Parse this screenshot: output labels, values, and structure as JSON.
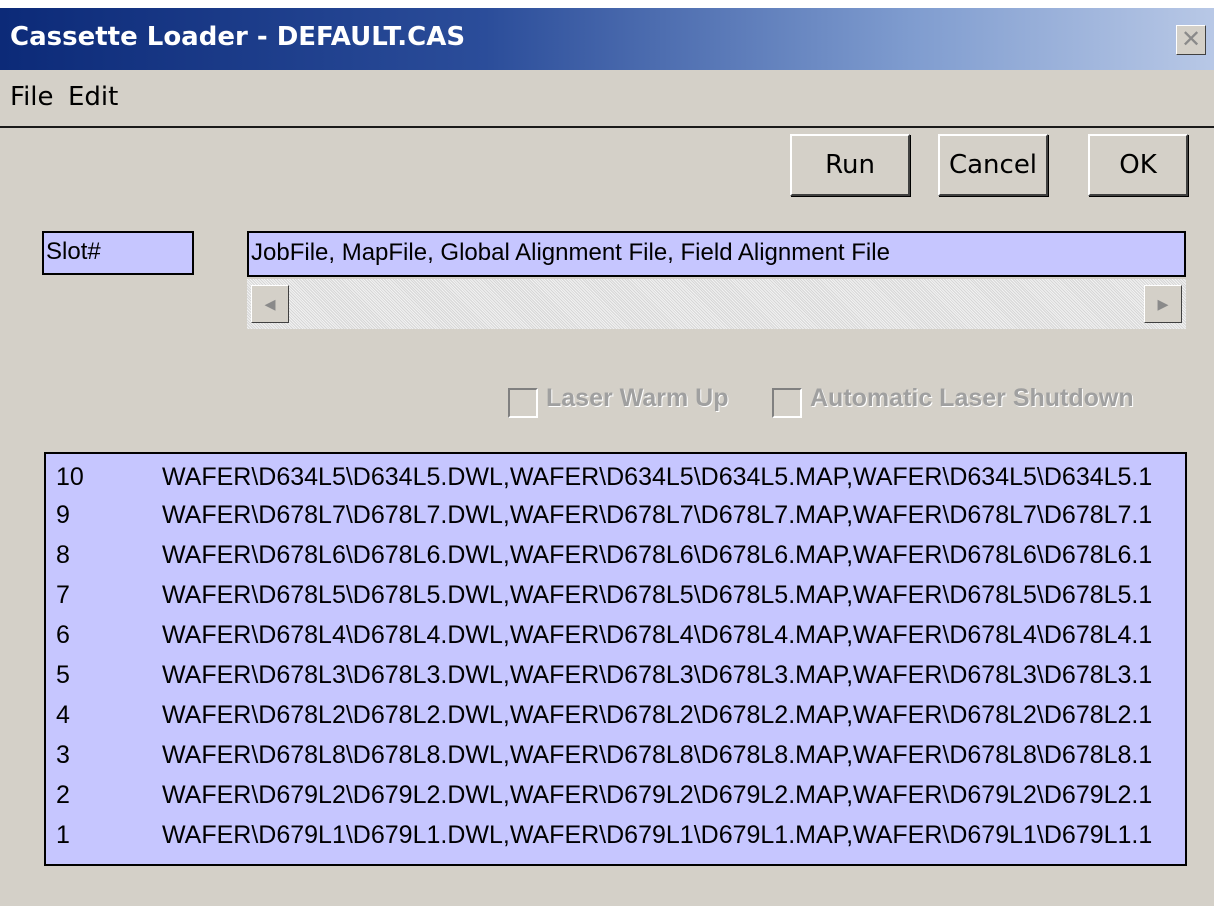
{
  "window": {
    "title": "Cassette Loader - DEFAULT.CAS",
    "close_glyph": "✕"
  },
  "menu": {
    "items": [
      {
        "label": "File"
      },
      {
        "label": "Edit"
      }
    ]
  },
  "toolbar": {
    "run_label": "Run",
    "cancel_label": "Cancel",
    "ok_label": "OK"
  },
  "header": {
    "slot_label": "Slot#",
    "files_label": "JobFile, MapFile, Global Alignment File, Field Alignment File"
  },
  "options": {
    "laser_warm_up": {
      "label": "Laser Warm Up",
      "checked": false,
      "enabled": false
    },
    "auto_shutdown": {
      "label": "Automatic Laser Shutdown",
      "checked": false,
      "enabled": false
    }
  },
  "cassette": {
    "rows": [
      {
        "slot": "10",
        "files": "WAFER\\D634L5\\D634L5.DWL,WAFER\\D634L5\\D634L5.MAP,WAFER\\D634L5\\D634L5.1"
      },
      {
        "slot": "9",
        "files": "WAFER\\D678L7\\D678L7.DWL,WAFER\\D678L7\\D678L7.MAP,WAFER\\D678L7\\D678L7.1"
      },
      {
        "slot": "8",
        "files": "WAFER\\D678L6\\D678L6.DWL,WAFER\\D678L6\\D678L6.MAP,WAFER\\D678L6\\D678L6.1"
      },
      {
        "slot": "7",
        "files": "WAFER\\D678L5\\D678L5.DWL,WAFER\\D678L5\\D678L5.MAP,WAFER\\D678L5\\D678L5.1"
      },
      {
        "slot": "6",
        "files": "WAFER\\D678L4\\D678L4.DWL,WAFER\\D678L4\\D678L4.MAP,WAFER\\D678L4\\D678L4.1"
      },
      {
        "slot": "5",
        "files": "WAFER\\D678L3\\D678L3.DWL,WAFER\\D678L3\\D678L3.MAP,WAFER\\D678L3\\D678L3.1"
      },
      {
        "slot": "4",
        "files": "WAFER\\D678L2\\D678L2.DWL,WAFER\\D678L2\\D678L2.MAP,WAFER\\D678L2\\D678L2.1"
      },
      {
        "slot": "3",
        "files": "WAFER\\D678L8\\D678L8.DWL,WAFER\\D678L8\\D678L8.MAP,WAFER\\D678L8\\D678L8.1"
      },
      {
        "slot": "2",
        "files": "WAFER\\D679L2\\D679L2.DWL,WAFER\\D679L2\\D679L2.MAP,WAFER\\D679L2\\D679L2.1"
      },
      {
        "slot": "1",
        "files": "WAFER\\D679L1\\D679L1.DWL,WAFER\\D679L1\\D679L1.MAP,WAFER\\D679L1\\D679L1.1"
      }
    ]
  },
  "colors": {
    "field_bg": "#c6c6ff",
    "dialog_bg": "#d4d0c8",
    "title_start": "#0c2a78",
    "title_end": "#b8c8e6"
  }
}
